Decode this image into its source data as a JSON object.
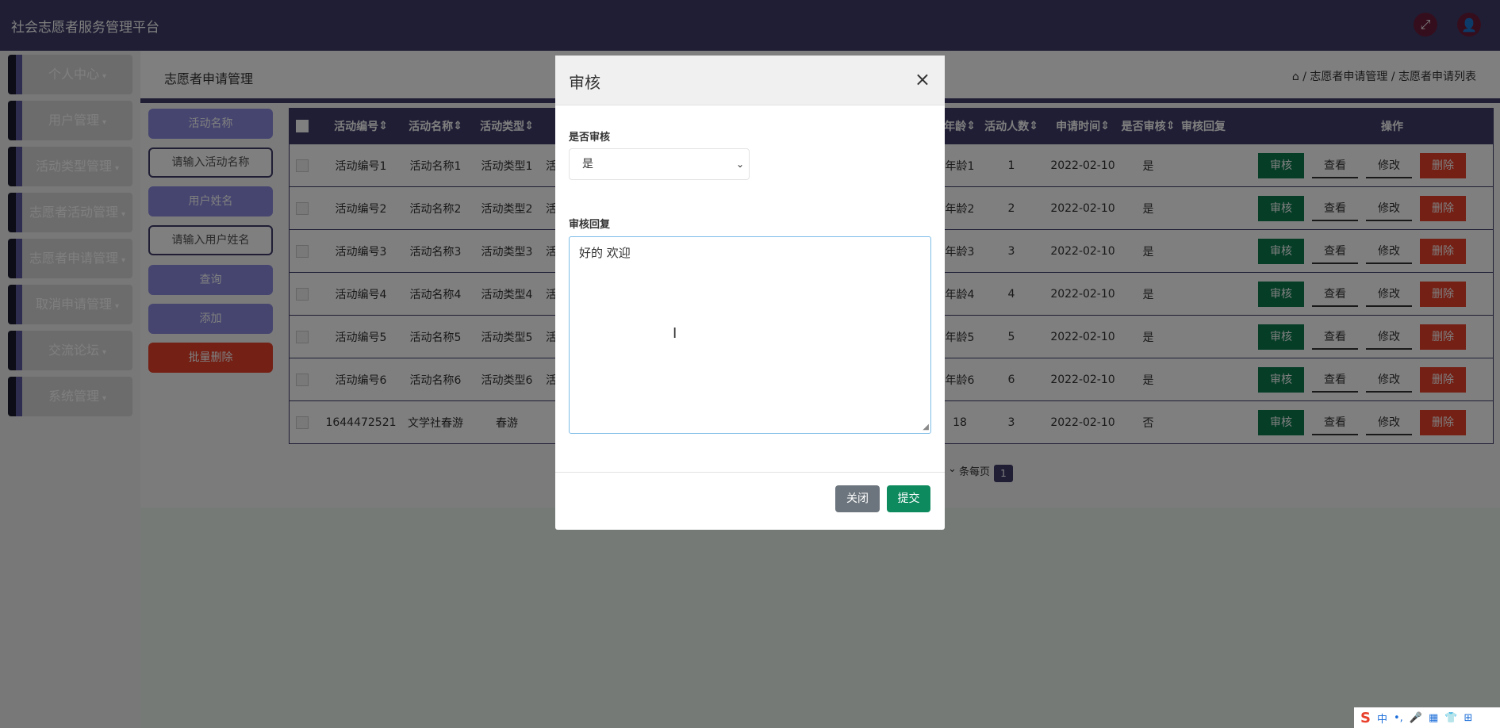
{
  "app": {
    "title": "社会志愿者服务管理平台"
  },
  "topbar": {
    "fullscreen_icon": "expand-icon",
    "user_icon": "user-icon"
  },
  "sidebar": {
    "items": [
      {
        "label": "个人中心"
      },
      {
        "label": "用户管理"
      },
      {
        "label": "活动类型管理"
      },
      {
        "label": "志愿者活动管理"
      },
      {
        "label": "志愿者申请管理"
      },
      {
        "label": "取消申请管理"
      },
      {
        "label": "交流论坛"
      },
      {
        "label": "系统管理"
      }
    ]
  },
  "page": {
    "title": "志愿者申请管理",
    "breadcrumb": "⌂ / 志愿者申请管理 / 志愿者申请列表"
  },
  "filters": {
    "activity_name_label": "活动名称",
    "activity_name_placeholder": "请输入活动名称",
    "user_name_label": "用户姓名",
    "user_name_placeholder": "请输入用户姓名",
    "search": "查询",
    "add": "添加",
    "batch_delete": "批量删除"
  },
  "table": {
    "headers": {
      "activity_no": "活动编号",
      "activity_name": "活动名称",
      "activity_type": "活动类型",
      "age": "年龄",
      "count": "活动人数",
      "apply_time": "申请时间",
      "audited": "是否审核",
      "reply": "审核回复",
      "ops": "操作"
    },
    "rows": [
      {
        "no": "活动编号1",
        "name": "活动名称1",
        "type": "活动类型1",
        "extra": "活",
        "age": "年龄1",
        "count": "1",
        "time": "2022-02-10",
        "audited": "是"
      },
      {
        "no": "活动编号2",
        "name": "活动名称2",
        "type": "活动类型2",
        "extra": "活",
        "age": "年龄2",
        "count": "2",
        "time": "2022-02-10",
        "audited": "是"
      },
      {
        "no": "活动编号3",
        "name": "活动名称3",
        "type": "活动类型3",
        "extra": "活",
        "age": "年龄3",
        "count": "3",
        "time": "2022-02-10",
        "audited": "是"
      },
      {
        "no": "活动编号4",
        "name": "活动名称4",
        "type": "活动类型4",
        "extra": "活",
        "age": "年龄4",
        "count": "4",
        "time": "2022-02-10",
        "audited": "是"
      },
      {
        "no": "活动编号5",
        "name": "活动名称5",
        "type": "活动类型5",
        "extra": "活",
        "age": "年龄5",
        "count": "5",
        "time": "2022-02-10",
        "audited": "是"
      },
      {
        "no": "活动编号6",
        "name": "活动名称6",
        "type": "活动类型6",
        "extra": "活",
        "age": "年龄6",
        "count": "6",
        "time": "2022-02-10",
        "audited": "是"
      },
      {
        "no": "1644472521",
        "name": "文学社春游",
        "type": "春游",
        "extra": "",
        "age": "18",
        "count": "3",
        "time": "2022-02-10",
        "audited": "否"
      }
    ],
    "ops": {
      "audit": "审核",
      "view": "查看",
      "edit": "修改",
      "delete": "删除"
    }
  },
  "pager": {
    "per_page": "条每页",
    "current": "1"
  },
  "modal": {
    "title": "审核",
    "audited_label": "是否审核",
    "audited_value": "是",
    "reply_label": "审核回复",
    "reply_value": "好的  欢迎",
    "close": "关闭",
    "submit": "提交"
  },
  "tray": {
    "items": [
      "中",
      "•,",
      "🎤",
      "▦",
      "👕",
      "⊞"
    ]
  }
}
